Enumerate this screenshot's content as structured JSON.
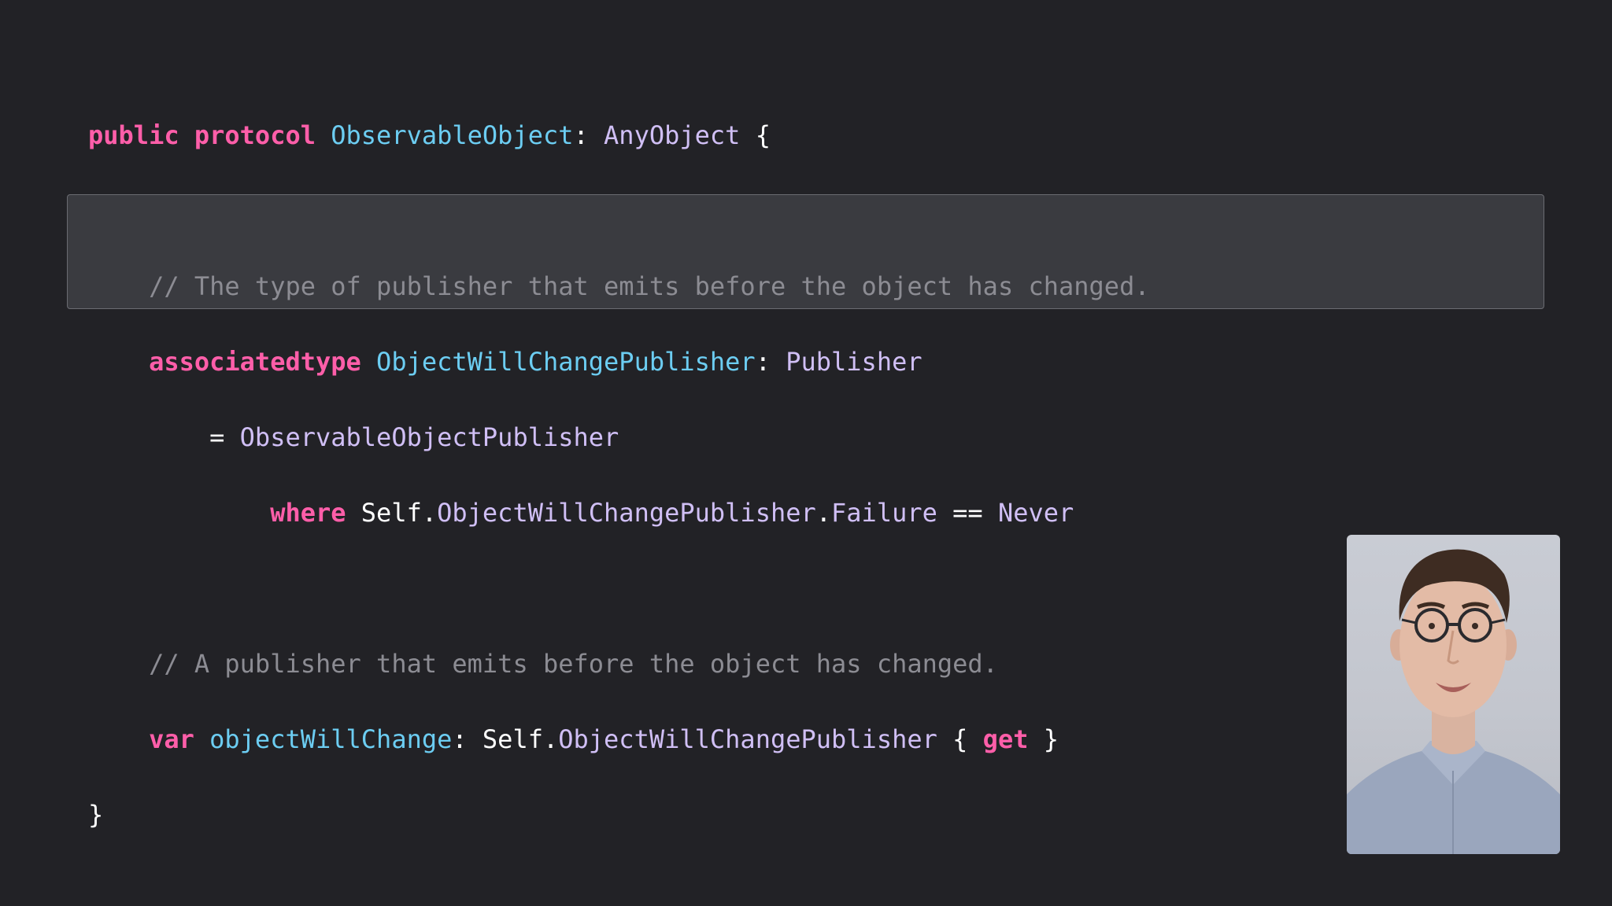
{
  "code": {
    "line1": {
      "kw1": "public",
      "kw2": "protocol",
      "name": "ObservableObject",
      "colon": ":",
      "type": "AnyObject",
      "brace": "{"
    },
    "comment1": "// The type of publisher that emits before the object has changed.",
    "line3": {
      "kw": "associatedtype",
      "name": "ObjectWillChangePublisher",
      "colon": ":",
      "type": "Publisher"
    },
    "line4": {
      "eq": "=",
      "type": "ObservableObjectPublisher"
    },
    "line5": {
      "kw": "where",
      "self": "Self",
      "dot1": ".",
      "assoc": "ObjectWillChangePublisher",
      "dot2": ".",
      "failure": "Failure",
      "op": "==",
      "never": "Never"
    },
    "comment2": "// A publisher that emits before the object has changed.",
    "line7": {
      "kw": "var",
      "name": "objectWillChange",
      "colon": ":",
      "self": "Self",
      "dot": ".",
      "type": "ObjectWillChangePublisher",
      "open": "{",
      "get": "get",
      "close": "}"
    },
    "closing": "}"
  },
  "colors": {
    "background": "#222226",
    "keyword": "#ff5ea9",
    "declaration": "#6ccdf2",
    "type": "#d0bff5",
    "comment": "#8c8c93",
    "highlight": "#3a3b40"
  },
  "presenter": {
    "icon": "presenter-video"
  }
}
